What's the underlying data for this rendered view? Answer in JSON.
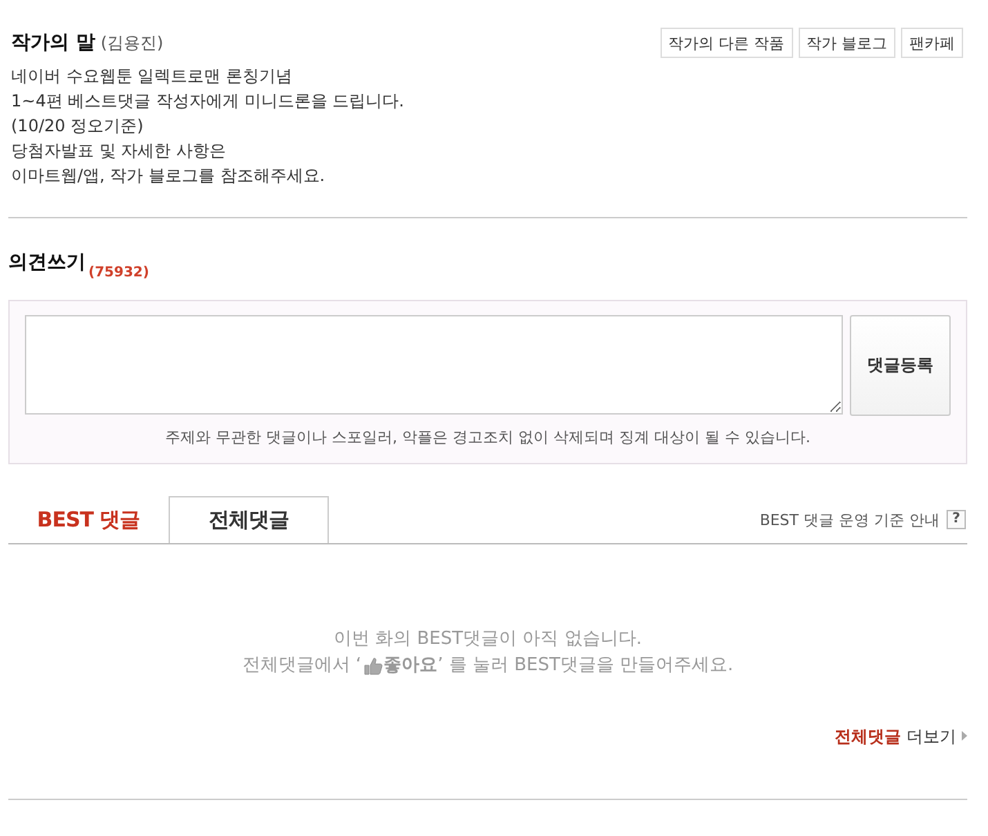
{
  "author_note": {
    "title": "작가의 말",
    "author": "(김용진)",
    "buttons": [
      "작가의 다른 작품",
      "작가 블로그",
      "팬카페"
    ],
    "lines": [
      "네이버 수요웹툰 일렉트로맨 론칭기념",
      "1~4편 베스트댓글 작성자에게 미니드론을 드립니다.",
      "(10/20 정오기준)",
      "당첨자발표 및 자세한 사항은",
      "이마트웹/앱, 작가 블로그를 참조해주세요."
    ]
  },
  "comment_form": {
    "title": "의견쓰기",
    "count": "(75932)",
    "submit": "댓글등록",
    "notice": "주제와 무관한 댓글이나 스포일러, 악플은 경고조치 없이 삭제되며 징계 대상이 될 수 있습니다."
  },
  "tabs": [
    {
      "label": "BEST 댓글",
      "selected": true
    },
    {
      "label": "전체댓글",
      "selected": false
    }
  ],
  "guide_link": {
    "label": "BEST 댓글 운영 기준 안내",
    "help": "?"
  },
  "empty_message": {
    "line_1": "이번 화의 BEST댓글이 아직 없습니다.",
    "line_2_before": "전체댓글에서 ‘",
    "line_2_after": "**좋아요**’ 를 눌러 BEST댓글을 만들어주세요."
  },
  "more_link": {
    "label": "전체댓글",
    "suffix": "더보기"
  }
}
